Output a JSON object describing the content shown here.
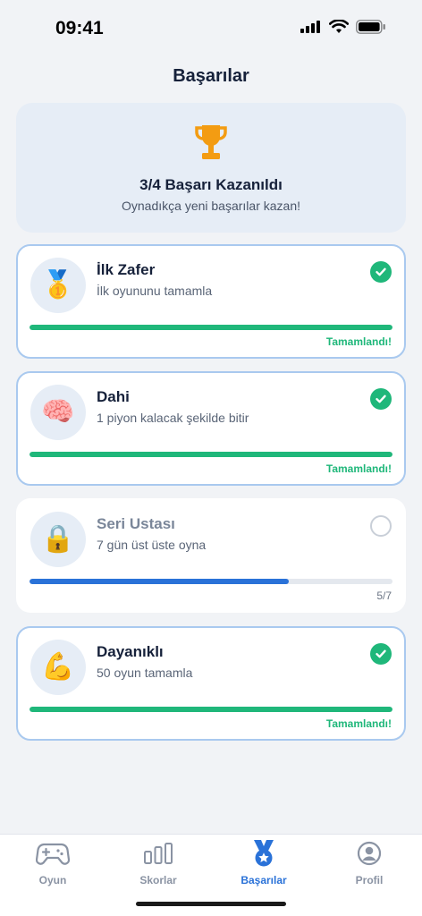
{
  "status": {
    "time": "09:41"
  },
  "page": {
    "title": "Başarılar"
  },
  "summary": {
    "title": "3/4 Başarı Kazanıldı",
    "subtitle": "Oynadıkça yeni başarılar kazan!",
    "icon": "trophy-icon"
  },
  "achievements": [
    {
      "title": "İlk Zafer",
      "description": "İlk oyununu tamamla",
      "icon": "🥇",
      "completed": true,
      "progress": 1.0,
      "status_label": "Tamamlandı!"
    },
    {
      "title": "Dahi",
      "description": "1 piyon kalacak şekilde bitir",
      "icon": "🧠",
      "completed": true,
      "progress": 1.0,
      "status_label": "Tamamlandı!"
    },
    {
      "title": "Seri Ustası",
      "description": "7 gün üst üste oyna",
      "icon": "🔒",
      "completed": false,
      "progress": 0.714,
      "status_label": "5/7"
    },
    {
      "title": "Dayanıklı",
      "description": "50 oyun tamamla",
      "icon": "💪",
      "completed": true,
      "progress": 1.0,
      "status_label": "Tamamlandı!"
    }
  ],
  "tabs": [
    {
      "label": "Oyun",
      "icon": "gamepad-icon",
      "active": false
    },
    {
      "label": "Skorlar",
      "icon": "bar-chart-icon",
      "active": false
    },
    {
      "label": "Başarılar",
      "icon": "medal-icon",
      "active": true
    },
    {
      "label": "Profil",
      "icon": "profile-icon",
      "active": false
    }
  ],
  "colors": {
    "accent": "#2a72d8",
    "success": "#1fb77a",
    "trophy": "#f39c12"
  }
}
